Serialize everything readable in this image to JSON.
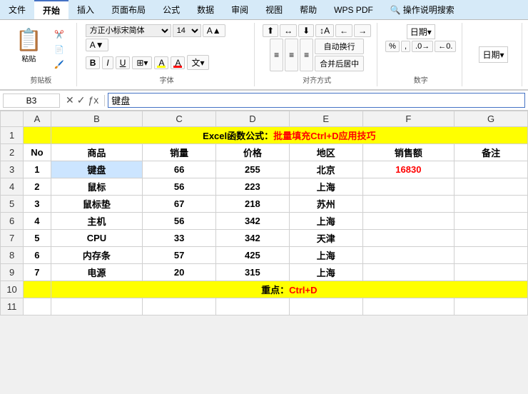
{
  "tabs": [
    "文件",
    "开始",
    "插入",
    "页面布局",
    "公式",
    "数据",
    "审阅",
    "视图",
    "帮助",
    "WPS PDF",
    "操作说明搜索"
  ],
  "activeTab": "开始",
  "ribbon": {
    "paste_label": "粘贴",
    "clipboard_label": "剪贴板",
    "font_face": "方正小标宋简体",
    "font_size": "14",
    "bold": "B",
    "italic": "I",
    "underline": "U",
    "font_group_label": "字体",
    "auto_wrap_label": "自动换行",
    "merge_label": "合并后居中",
    "align_group_label": "对齐方式",
    "number_format": "日期",
    "number_group_label": "数字"
  },
  "formula_bar": {
    "name_box": "B3",
    "formula_content": "键盘"
  },
  "sheet": {
    "col_headers": [
      "",
      "A",
      "B",
      "C",
      "D",
      "E",
      "F",
      "G"
    ],
    "rows": [
      {
        "row_num": "1",
        "cells": [
          "",
          "",
          "",
          "",
          "",
          "",
          "",
          ""
        ],
        "special": "title",
        "title_text": "Excel函数公式：",
        "title_red": "批量填充Ctrl+D应用技巧"
      },
      {
        "row_num": "2",
        "cells": [
          "",
          "No",
          "商品",
          "销量",
          "价格",
          "地区",
          "销售额",
          "备注"
        ]
      },
      {
        "row_num": "3",
        "cells": [
          "",
          "1",
          "键盘",
          "66",
          "255",
          "北京",
          "16830",
          ""
        ],
        "highlight_f": true,
        "selected_b": true
      },
      {
        "row_num": "4",
        "cells": [
          "",
          "2",
          "鼠标",
          "56",
          "223",
          "上海",
          "",
          ""
        ]
      },
      {
        "row_num": "5",
        "cells": [
          "",
          "3",
          "鼠标垫",
          "67",
          "218",
          "苏州",
          "",
          ""
        ]
      },
      {
        "row_num": "6",
        "cells": [
          "",
          "4",
          "主机",
          "56",
          "342",
          "上海",
          "",
          ""
        ]
      },
      {
        "row_num": "7",
        "cells": [
          "",
          "5",
          "CPU",
          "33",
          "342",
          "天津",
          "",
          ""
        ]
      },
      {
        "row_num": "8",
        "cells": [
          "",
          "6",
          "内存条",
          "57",
          "425",
          "上海",
          "",
          ""
        ]
      },
      {
        "row_num": "9",
        "cells": [
          "",
          "7",
          "电源",
          "20",
          "315",
          "上海",
          "",
          ""
        ]
      },
      {
        "row_num": "10",
        "cells": [
          "",
          "",
          "",
          "",
          "",
          "",
          "",
          ""
        ],
        "special": "bottom",
        "bottom_text": "重点：",
        "bottom_red": "Ctrl+D"
      },
      {
        "row_num": "11",
        "cells": [
          "",
          "",
          "",
          "",
          "",
          "",
          "",
          ""
        ]
      }
    ]
  }
}
